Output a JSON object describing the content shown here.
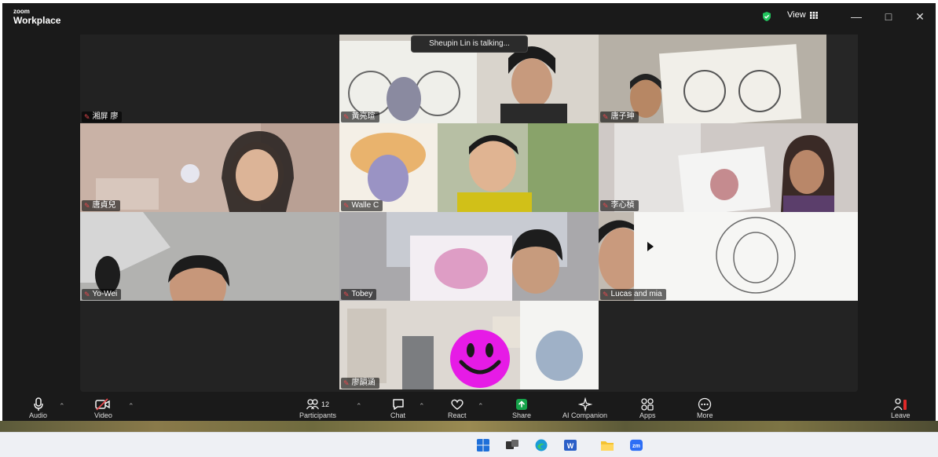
{
  "app": {
    "brand_top": "zoom",
    "brand_bottom": "Workplace",
    "view_label": "View",
    "talking_banner": "Sheupin Lin is talking..."
  },
  "tiles": [
    {
      "name": "湘屏 廖"
    },
    {
      "name": "黃亮瑄"
    },
    {
      "name": "唐子珅"
    },
    {
      "name": "唐貞兒"
    },
    {
      "name": "Walle C"
    },
    {
      "name": "李心楨"
    },
    {
      "name": "Yo-Wei"
    },
    {
      "name": "Tobey"
    },
    {
      "name": "Lucas and mia"
    },
    {
      "name": "廖韻涵"
    }
  ],
  "toolbar": {
    "audio": "Audio",
    "video": "Video",
    "participants": "Participants",
    "participants_count": "12",
    "chat": "Chat",
    "react": "React",
    "share": "Share",
    "ai_companion": "AI Companion",
    "apps": "Apps",
    "more": "More",
    "leave": "Leave"
  },
  "icons": [
    "microphone-icon",
    "video-off-icon",
    "participants-icon",
    "chat-icon",
    "react-icon",
    "share-icon",
    "ai-companion-icon",
    "apps-icon",
    "more-icon",
    "leave-icon",
    "shield-icon",
    "grid-icon",
    "minimize-icon",
    "maximize-icon",
    "close-icon"
  ],
  "colors": {
    "window_bg": "#1a1a1a",
    "share_green": "#16a34a",
    "mic_off_red": "#e5484d",
    "leave_red": "#e02828",
    "smiley_magenta": "#e61be6"
  }
}
